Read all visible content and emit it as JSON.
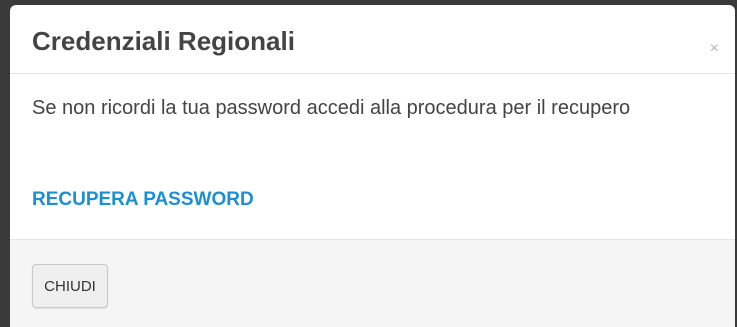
{
  "modal": {
    "title": "Credenziali Regionali",
    "close_icon": "×",
    "body_text": "Se non ricordi la tua password accedi alla procedura per il recupero",
    "recover_link_label": "RECUPERA PASSWORD",
    "footer_button_label": "CHIUDI"
  },
  "colors": {
    "link": "#1a8fd1",
    "text": "#444444",
    "footer_background": "#f5f5f5"
  }
}
